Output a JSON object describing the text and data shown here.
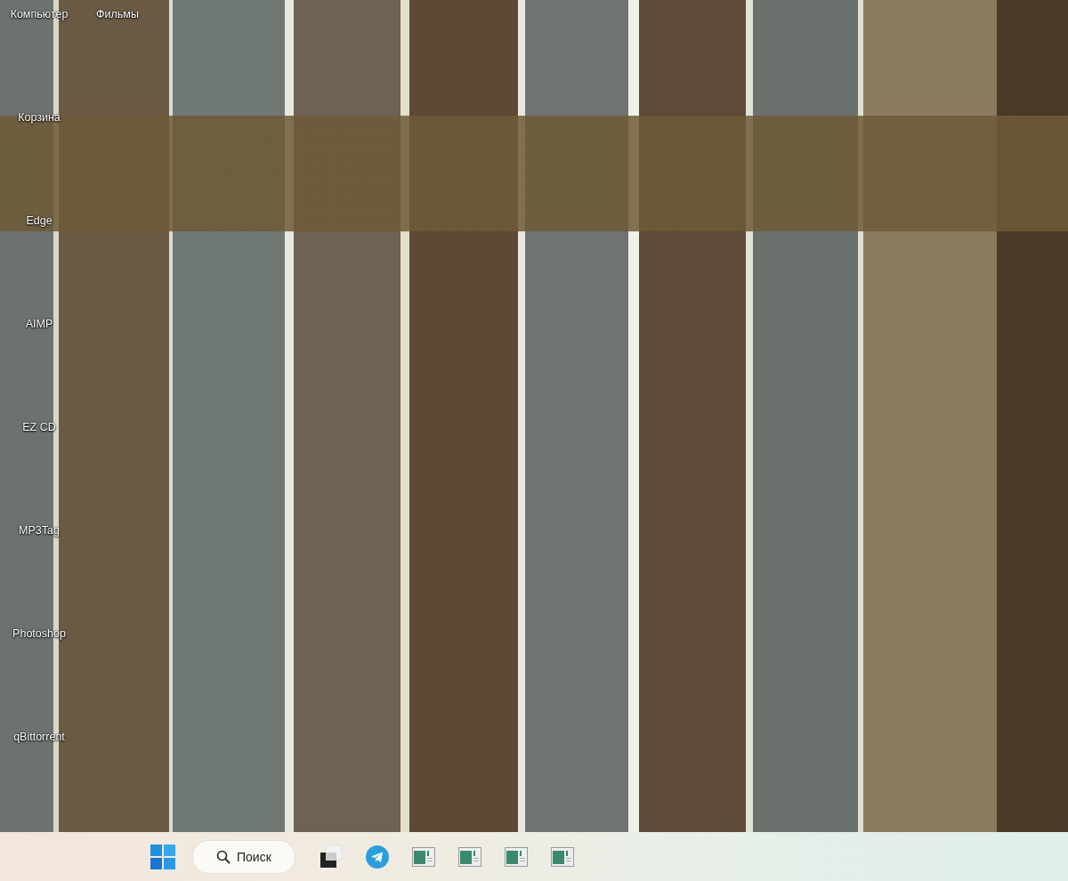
{
  "desktop": {
    "columns": [
      {
        "icons": [
          {
            "label": "Компьютер"
          },
          {
            "label": "Корзина"
          },
          {
            "label": "Edge"
          },
          {
            "label": "AIMP"
          },
          {
            "label": "EZ CD"
          },
          {
            "label": "MP3Tag"
          },
          {
            "label": "Photoshop"
          },
          {
            "label": "qBittorrent"
          }
        ]
      },
      {
        "icons": [
          {
            "label": "Фильмы"
          }
        ]
      }
    ]
  },
  "taskbar": {
    "search": {
      "label": "Поиск"
    },
    "apps": [
      {
        "kind": "task-view"
      },
      {
        "kind": "paper-plane"
      },
      {
        "kind": "window"
      },
      {
        "kind": "window"
      },
      {
        "kind": "window"
      },
      {
        "kind": "window"
      }
    ]
  }
}
